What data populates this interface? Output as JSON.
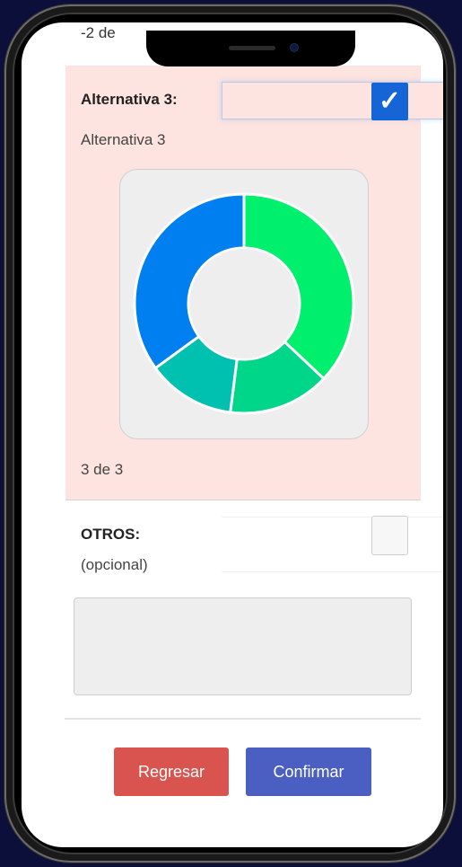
{
  "partial_header": "-2 de",
  "alternative": {
    "label": "Alternativa 3:",
    "subtitle": "Alternativa 3",
    "checked": true,
    "count_text": "3 de 3",
    "highlight_color": "#fde4e0"
  },
  "chart_data": {
    "type": "pie",
    "subtype": "donut",
    "title": "",
    "slices": [
      {
        "value": 37,
        "color": "#00f06e"
      },
      {
        "value": 15,
        "color": "#00d68a"
      },
      {
        "value": 13,
        "color": "#00c0b0"
      },
      {
        "value": 35,
        "color": "#0080f0"
      }
    ]
  },
  "otros": {
    "label": "OTROS:",
    "sublabel": "(opcional)",
    "checked": false,
    "textarea_value": ""
  },
  "buttons": {
    "back": "Regresar",
    "confirm": "Confirmar"
  },
  "colors": {
    "back_button": "#d9534f",
    "confirm_button": "#4a5fc1",
    "check_selected": "#1565d6",
    "device_background": "#0b0f3a"
  }
}
